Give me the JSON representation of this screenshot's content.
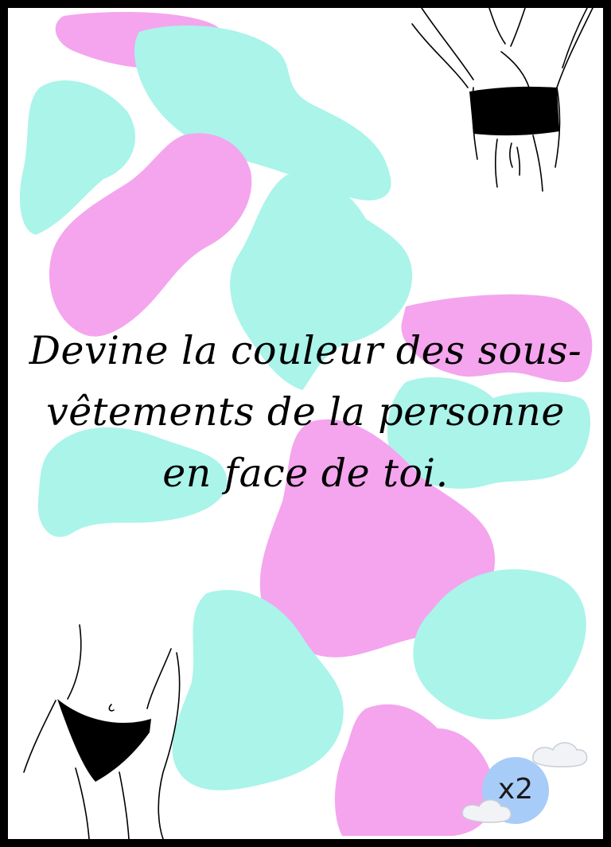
{
  "card": {
    "prompt": "Devine la couleur des sous-vêtements de la personne en face de toi.",
    "count_badge": "x2"
  },
  "colors": {
    "pink": "#f4a5ee",
    "mint": "#aaf4ea",
    "badge": "#a8ccf8",
    "border": "#000000",
    "cloud": "#f2f3f7"
  },
  "illustrations": [
    "torso-bandeau-top",
    "hips-black-briefs"
  ]
}
